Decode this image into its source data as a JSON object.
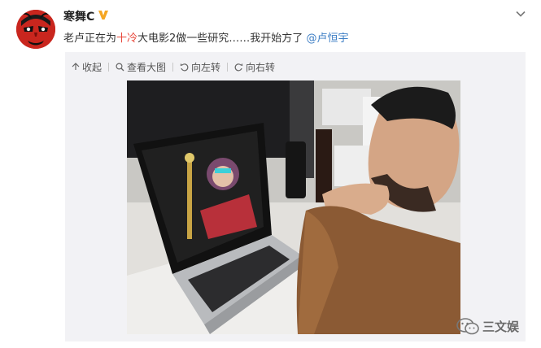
{
  "post": {
    "username": "寒舞C",
    "verified_badge": "V",
    "text_prefix": "老卢正在为",
    "text_highlight": "十冷",
    "text_middle": "大电影2做一些研究……我开始方了 ",
    "mention": "@卢恒宇",
    "icons": {
      "menu": "chevron-down-icon",
      "avatar": "red-mask-avatar"
    }
  },
  "toolbar": {
    "collapse_label": "收起",
    "view_large_label": "查看大图",
    "rotate_left_label": "向左转",
    "rotate_right_label": "向右转"
  },
  "watermark": {
    "text": "三文娱"
  },
  "colors": {
    "highlight": "#e8483b",
    "mention": "#3b7dc4",
    "badge": "#f5a623",
    "media_bg": "#f2f2f5"
  }
}
